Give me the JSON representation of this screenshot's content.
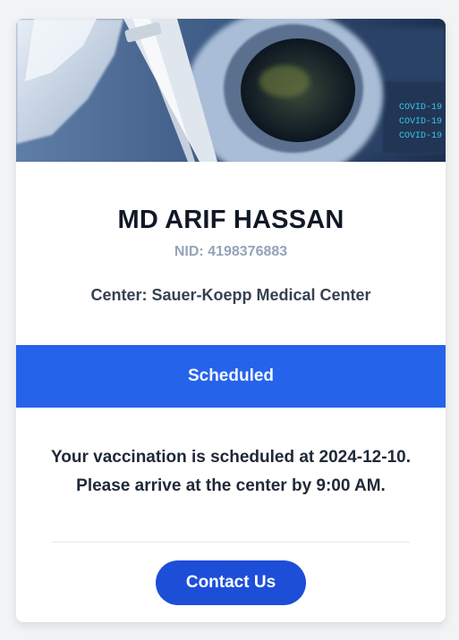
{
  "patient": {
    "name": "MD ARIF HASSAN",
    "nid": "NID: 4198376883",
    "center": "Center: Sauer-Koepp Medical Center"
  },
  "status": {
    "label": "Scheduled",
    "color": "#2563eb"
  },
  "message": {
    "line1": "Your vaccination is scheduled at 2024-12-10.",
    "line2": "Please arrive at the center by 9:00 AM."
  },
  "hero": {
    "screen_lines": [
      "COVID-19",
      "COVID-19",
      "COVID-19"
    ]
  },
  "actions": {
    "contact_label": "Contact Us",
    "contact_color": "#1d4ed8"
  }
}
